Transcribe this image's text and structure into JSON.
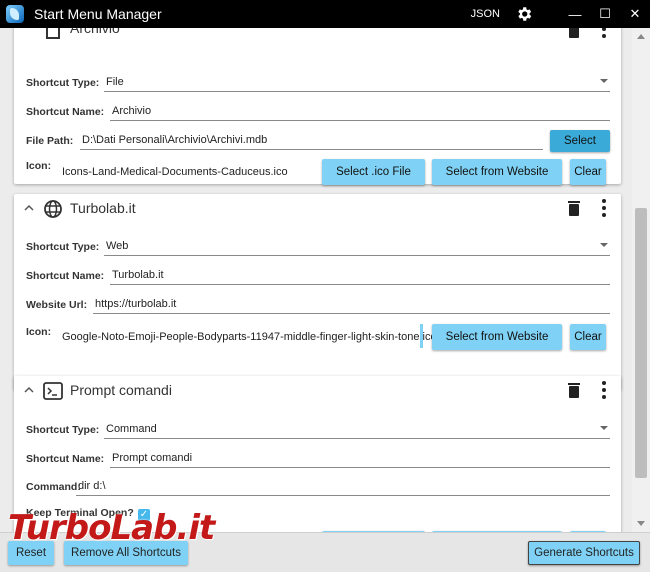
{
  "window": {
    "title": "Start Menu Manager",
    "json_label": "JSON",
    "minimize": "—",
    "maximize": "☐",
    "close": "✕"
  },
  "cards": [
    {
      "title": "Archivio",
      "type_icon": "document-icon",
      "fields": {
        "shortcut_type_label": "Shortcut Type:",
        "shortcut_type": "File",
        "shortcut_name_label": "Shortcut Name:",
        "shortcut_name": "Archivio",
        "path_label": "File Path:",
        "path": "D:\\Dati Personali\\Archivio\\Archivi.mdb",
        "select_label": "Select",
        "icon_label": "Icon:",
        "icon": "Icons-Land-Medical-Documents-Caduceus.ico",
        "select_ico_label": "Select .ico File",
        "select_website_label": "Select from Website",
        "clear_label": "Clear"
      }
    },
    {
      "title": "Turbolab.it",
      "type_icon": "globe-icon",
      "fields": {
        "shortcut_type_label": "Shortcut Type:",
        "shortcut_type": "Web",
        "shortcut_name_label": "Shortcut Name:",
        "shortcut_name": "Turbolab.it",
        "url_label": "Website Url:",
        "url": "https://turbolab.it",
        "icon_label": "Icon:",
        "icon": "Google-Noto-Emoji-People-Bodyparts-11947-middle-finger-light-skin-tone.ico",
        "select_website_label": "Select from Website",
        "clear_label": "Clear"
      }
    },
    {
      "title": "Prompt comandi",
      "type_icon": "terminal-icon",
      "fields": {
        "shortcut_type_label": "Shortcut Type:",
        "shortcut_type": "Command",
        "shortcut_name_label": "Shortcut Name:",
        "shortcut_name": "Prompt comandi",
        "command_label": "Command:",
        "command": "dir d:\\",
        "keep_open_label": "Keep Terminal Open?",
        "keep_open": true
      }
    }
  ],
  "bottom": {
    "reset_label": "Reset",
    "remove_all_label": "Remove All Shortcuts",
    "generate_label": "Generate Shortcuts"
  },
  "watermark": "TurboLab.it",
  "colors": {
    "accent": "#7fd2f5",
    "accent_dark": "#3aaad8",
    "titlebar": "#000000",
    "checkbox": "#45b8ec"
  }
}
